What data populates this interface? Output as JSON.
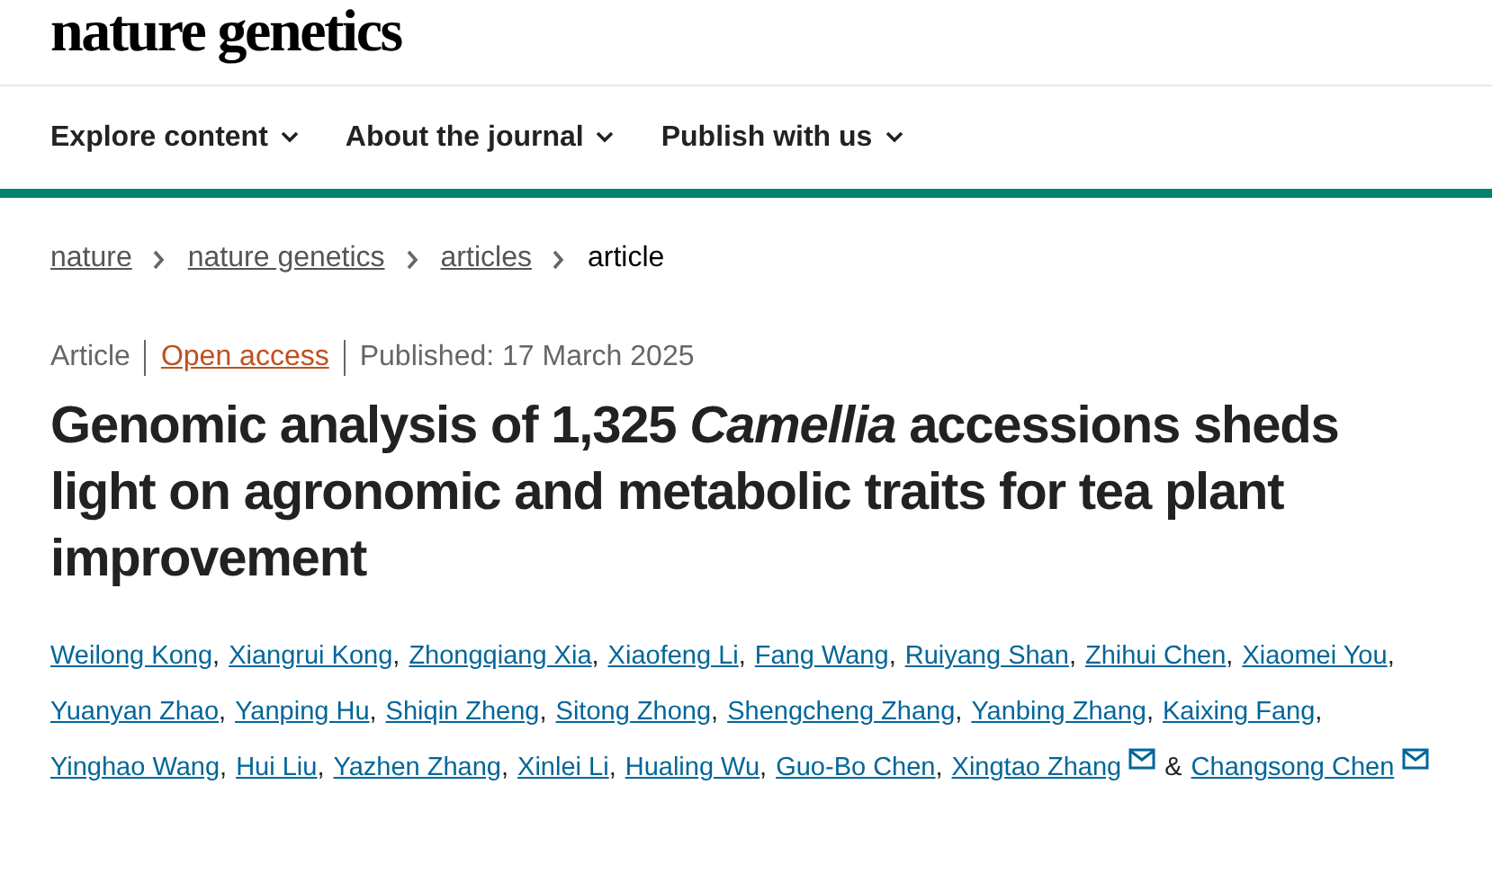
{
  "logo": "nature genetics",
  "nav": [
    {
      "label": "Explore content"
    },
    {
      "label": "About the journal"
    },
    {
      "label": "Publish with us"
    }
  ],
  "breadcrumb": [
    {
      "label": "nature",
      "link": true
    },
    {
      "label": "nature genetics",
      "link": true
    },
    {
      "label": "articles",
      "link": true
    },
    {
      "label": "article",
      "link": false
    }
  ],
  "meta": {
    "type": "Article",
    "access": "Open access",
    "published": "Published: 17 March 2025"
  },
  "title": "Genomic analysis of 1,325 *Camellia* accessions sheds light on agronomic and metabolic traits for tea plant improvement",
  "authors": [
    {
      "name": "Weilong Kong",
      "email": false
    },
    {
      "name": "Xiangrui Kong",
      "email": false
    },
    {
      "name": "Zhongqiang Xia",
      "email": false
    },
    {
      "name": "Xiaofeng Li",
      "email": false
    },
    {
      "name": "Fang Wang",
      "email": false
    },
    {
      "name": "Ruiyang Shan",
      "email": false
    },
    {
      "name": "Zhihui Chen",
      "email": false
    },
    {
      "name": "Xiaomei You",
      "email": false
    },
    {
      "name": "Yuanyan Zhao",
      "email": false
    },
    {
      "name": "Yanping Hu",
      "email": false
    },
    {
      "name": "Shiqin Zheng",
      "email": false
    },
    {
      "name": "Sitong Zhong",
      "email": false
    },
    {
      "name": "Shengcheng Zhang",
      "email": false
    },
    {
      "name": "Yanbing Zhang",
      "email": false
    },
    {
      "name": "Kaixing Fang",
      "email": false
    },
    {
      "name": "Yinghao Wang",
      "email": false
    },
    {
      "name": "Hui Liu",
      "email": false
    },
    {
      "name": "Yazhen Zhang",
      "email": false
    },
    {
      "name": "Xinlei Li",
      "email": false
    },
    {
      "name": "Hualing Wu",
      "email": false
    },
    {
      "name": "Guo-Bo Chen",
      "email": false
    },
    {
      "name": "Xingtao Zhang",
      "email": true
    },
    {
      "name": "Changsong Chen",
      "email": true
    }
  ],
  "author_separator": ",",
  "author_last_joiner": "&"
}
